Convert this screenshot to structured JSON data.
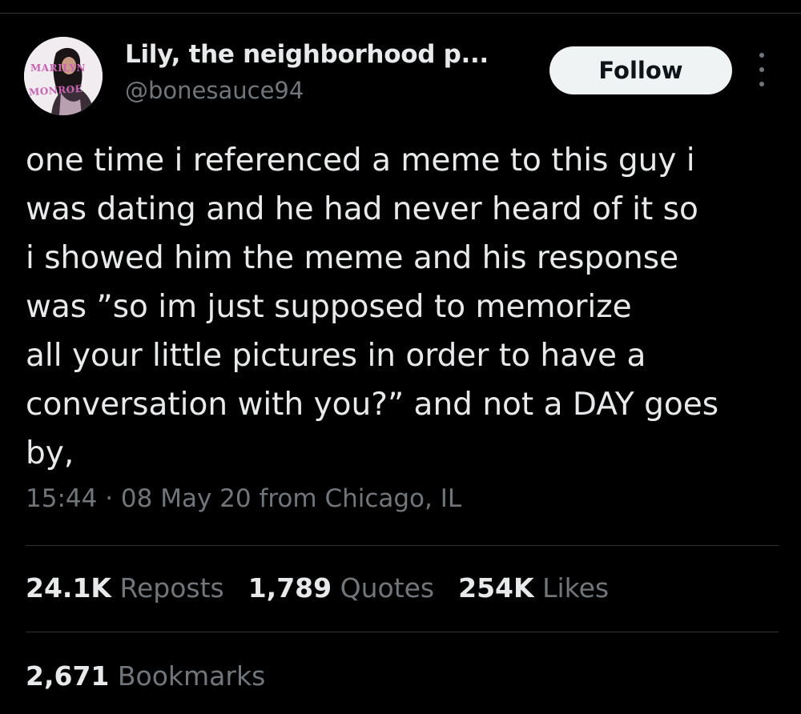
{
  "author": {
    "display_name": "Lily, the neighborhood p...",
    "handle": "@bonesauce94",
    "avatar_text_line1": "MARILYN",
    "avatar_text_line2": "MONROE"
  },
  "header": {
    "follow_label": "Follow",
    "more_icon": "more-vertical-icon"
  },
  "tweet": {
    "text": "one time i referenced a meme to this guy i\nwas dating and he had never heard of it so\ni showed him the meme and his response\nwas ”so im just supposed to memorize\nall your little pictures in order to have a\nconversation with you?” and not a DAY goes\nby,",
    "timestamp": "15:44 · 08 May 20 from Chicago, IL"
  },
  "stats": {
    "reposts_count": "24.1K",
    "reposts_label": "Reposts",
    "quotes_count": "1,789",
    "quotes_label": "Quotes",
    "likes_count": "254K",
    "likes_label": "Likes",
    "bookmarks_count": "2,671",
    "bookmarks_label": "Bookmarks"
  },
  "colors": {
    "background": "#000000",
    "primary_text": "#e7e9ea",
    "secondary_text": "#71767b",
    "divider": "#2f3336",
    "follow_button_bg": "#eff3f4",
    "follow_button_text": "#0f1419"
  }
}
